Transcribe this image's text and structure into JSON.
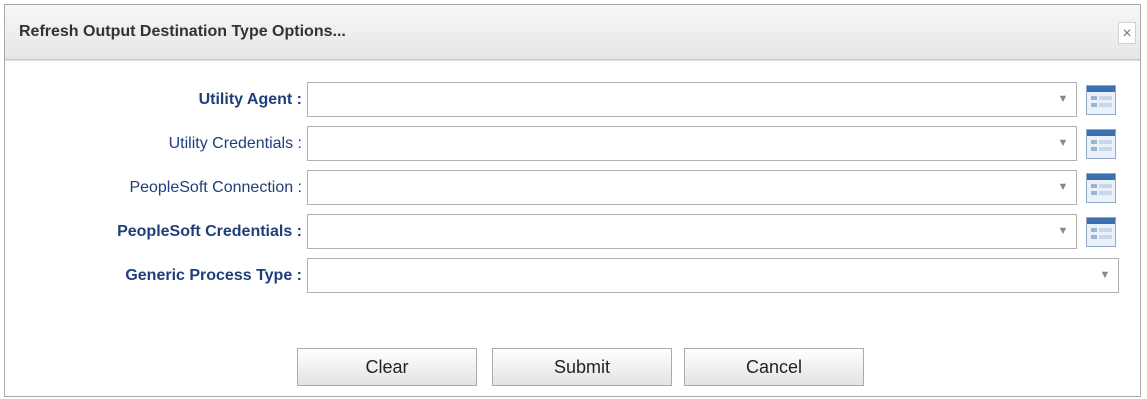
{
  "dialog": {
    "title": "Refresh Output Destination Type Options...",
    "close_glyph": "×"
  },
  "fields": [
    {
      "label": "Utility Agent :",
      "value": "",
      "required": true,
      "has_lookup": true
    },
    {
      "label": "Utility Credentials :",
      "value": "",
      "required": false,
      "has_lookup": true
    },
    {
      "label": "PeopleSoft Connection :",
      "value": "",
      "required": false,
      "has_lookup": true
    },
    {
      "label": "PeopleSoft Credentials :",
      "value": "",
      "required": true,
      "has_lookup": true
    },
    {
      "label": "Generic Process Type :",
      "value": "",
      "required": true,
      "has_lookup": false
    }
  ],
  "buttons": {
    "clear": "Clear",
    "submit": "Submit",
    "cancel": "Cancel"
  },
  "icons": {
    "dropdown": "chevron-down-icon",
    "lookup": "list-lookup-icon",
    "close": "close-icon"
  },
  "colors": {
    "label": "#1f3f7a",
    "lookup_header": "#3b6fb0"
  }
}
